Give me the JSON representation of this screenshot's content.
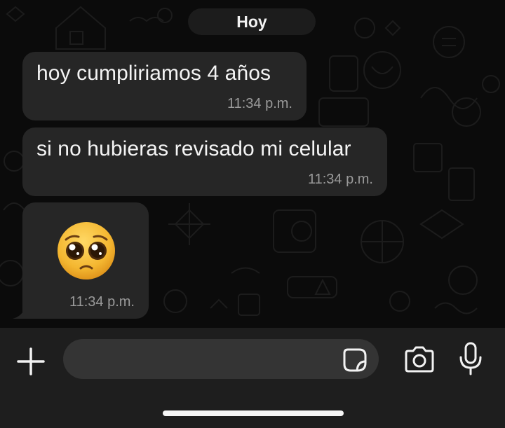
{
  "date_separator": "Hoy",
  "messages": [
    {
      "text": "hoy cumpliriamos 4 años",
      "time": "11:34 p.m."
    },
    {
      "text": "si no hubieras revisado mi celular",
      "time": "11:34 p.m."
    },
    {
      "emoji": "pleading-face",
      "time": "11:34 p.m."
    }
  ],
  "composer": {
    "placeholder": "",
    "icons": [
      "plus-icon",
      "sticker-icon",
      "camera-icon",
      "microphone-icon"
    ]
  },
  "colors": {
    "background": "#0b0b0b",
    "bubble": "#262626",
    "input_bar": "#1e1e1e",
    "input_field": "#343434",
    "timestamp": "#9a9a9a",
    "emoji_face": "#f4b731"
  }
}
